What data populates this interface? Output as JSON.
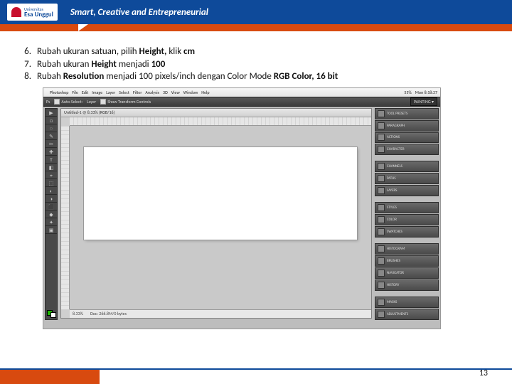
{
  "header": {
    "university_small": "Universitas",
    "university_name": "Esa Unggul",
    "tagline": "Smart, Creative and Entrepreneurial"
  },
  "instructions": [
    {
      "n": "6.",
      "parts": [
        "Rubah ukuran satuan, pilih ",
        "Height,",
        " klik ",
        "cm"
      ]
    },
    {
      "n": "7.",
      "parts": [
        "Rubah ukuran ",
        "Height",
        " menjadi ",
        "100"
      ]
    },
    {
      "n": "8.",
      "parts": [
        "Rubah ",
        "Resolution",
        " menjadi 100 pixels/inch dengan Color Mode ",
        "RGB Color, 16 bit"
      ]
    }
  ],
  "photoshop": {
    "mac_menu": [
      "Photoshop",
      "File",
      "Edit",
      "Image",
      "Layer",
      "Select",
      "Filter",
      "Analysis",
      "3D",
      "View",
      "Window",
      "Help"
    ],
    "mac_right": [
      "55%",
      "Mon 8:18:37"
    ],
    "options": {
      "auto_select": "Auto-Select:",
      "layer": "Layer",
      "show_tf": "Show Transform Controls",
      "workspace": "PAINTING ▾"
    },
    "tab_title": "Untitled-1 @ 8.33% (RGB/16)",
    "status_zoom": "8.33%",
    "status_doc": "Doc: 266.8M/0 bytes",
    "panels": [
      "TOOL PRESETS",
      "PARAGRAPH",
      "ACTIONS",
      "CHARACTER",
      "CHANNELS",
      "PATHS",
      "LAYERS",
      "STYLES",
      "COLOR",
      "SWATCHES",
      "HISTOGRAM",
      "BRUSHES",
      "NAVIGATOR",
      "HISTORY",
      "MASKS",
      "ADJUSTMENTS"
    ],
    "tools": [
      "▶",
      "□",
      "◌",
      "✎",
      "✂",
      "✚",
      "T",
      "◧",
      "⌖",
      "⬚",
      "◐",
      "◑",
      "⬛",
      "◆",
      "✦",
      "▣"
    ]
  },
  "page_number": "13"
}
